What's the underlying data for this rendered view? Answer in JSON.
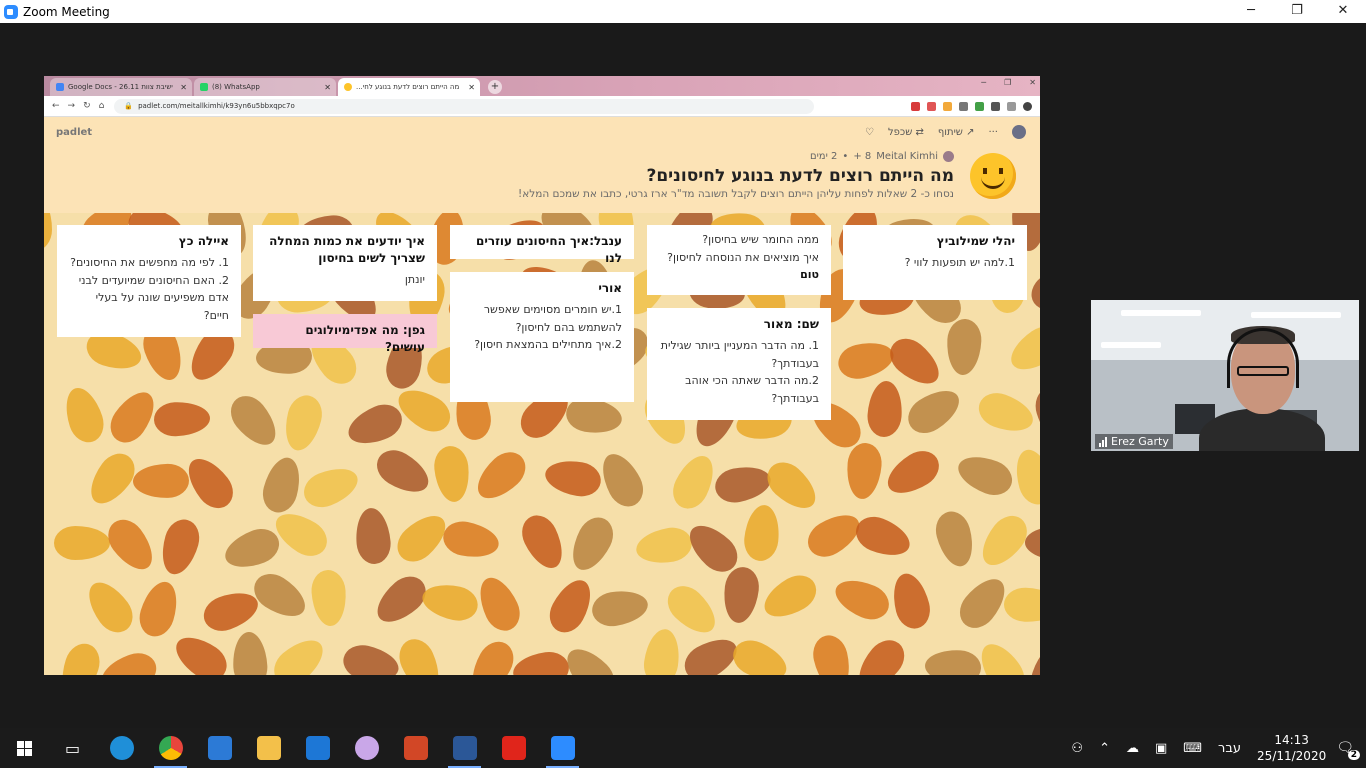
{
  "zoom": {
    "title": "Zoom Meeting",
    "window_controls": {
      "minimize": "─",
      "restore": "❐",
      "close": "✕"
    }
  },
  "browser": {
    "tabs": [
      {
        "label": "Google Docs - 26.11 ישיבת צוות",
        "active": false,
        "favicon_color": "#4285f4"
      },
      {
        "label": "(8) WhatsApp",
        "active": false,
        "favicon_color": "#25d366"
      },
      {
        "label": "מה הייתם רוצים לדעת בנוגע לחי...",
        "active": true,
        "favicon_color": "#fdc42a"
      }
    ],
    "new_tab": "+",
    "url": "padlet.com/meitallkimhi/k93yn6u5bbxqpc7o"
  },
  "padlet": {
    "brand": "padlet",
    "actions": {
      "share": "שיתוף",
      "remake": "שכפל",
      "more": "···"
    },
    "author": "Meital Kimhi",
    "contributors": "+ 8",
    "age": "2 ימים",
    "title": "מה הייתם רוצים לדעת בנוגע לחיסונים?",
    "subtitle": "נסחו כ- 2 שאלות לפחות עליהן הייתם רוצים לקבל תשובה מד\"ר ארז גרטי, כתבו את שמכם המלא!",
    "add_button": "+",
    "cards": [
      {
        "title": "יהלי שמילוביץ",
        "lines": [
          "1.למה יש תופעות לווי ?"
        ]
      },
      {
        "title": "",
        "lines": [
          "ממה החומר שיש בחיסון?",
          "איך מוציאים את הנוסחה לחיסון?"
        ],
        "footer": "טום"
      },
      {
        "title": "שם: מאור",
        "lines": [
          "1. מה הדבר המעניין ביותר שגילית בעבודתך?",
          "2.מה הדבר שאתה הכי אוהב בעבודתך?"
        ]
      },
      {
        "title": "ענבל:איך החיסונים עוזרים לנו",
        "lines": []
      },
      {
        "title": "אורי",
        "lines": [
          "1.יש חומרים מסוימים שאפשר להשתמש בהם לחיסון?",
          "2.איך מתחילים בהמצאת חיסון?"
        ]
      },
      {
        "title": "איך יודעים את כמות המחלה שצריך לשים בחיסון",
        "lines": [
          "יונתן"
        ]
      },
      {
        "title": "גפן: מה אפדימיולוגים עושים?",
        "lines": []
      },
      {
        "title": "איילה כץ",
        "lines": [
          "1. לפי מה מחפשים את החיסונים?",
          "2. האם החיסונים שמיועדים לבני אדם משפיעים שונה על בעלי חיים?"
        ]
      }
    ]
  },
  "video": {
    "participant": "Erez Garty"
  },
  "taskbar": {
    "apps": [
      {
        "name": "task-view",
        "color": "#1b1b1b"
      },
      {
        "name": "edge",
        "color": "#1f8fd8"
      },
      {
        "name": "chrome",
        "color": "#e8453c"
      },
      {
        "name": "store",
        "color": "#2c7ad6"
      },
      {
        "name": "file-explorer",
        "color": "#f3c04a"
      },
      {
        "name": "mail",
        "color": "#1d77d6"
      },
      {
        "name": "paint",
        "color": "#c9a7e8"
      },
      {
        "name": "powerpoint",
        "color": "#d24726"
      },
      {
        "name": "word",
        "color": "#2b5797"
      },
      {
        "name": "acrobat",
        "color": "#e0251b"
      },
      {
        "name": "zoom",
        "color": "#2d8cff"
      }
    ],
    "language": "עבר",
    "time": "14:13",
    "date": "25/11/2020",
    "notifications": "2"
  }
}
